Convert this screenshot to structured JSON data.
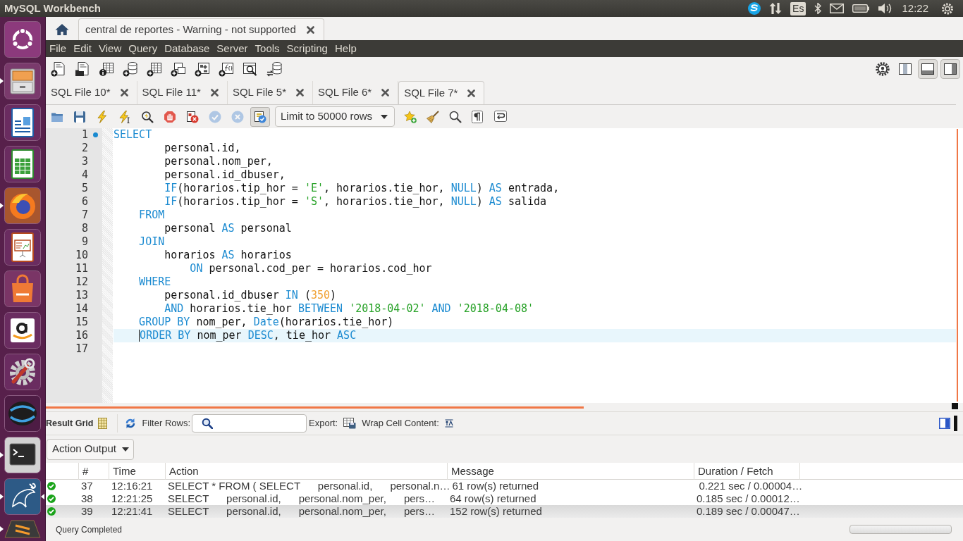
{
  "top_panel": {
    "title": "MySQL Workbench",
    "keyboard_layout": "Es",
    "clock": "12:22"
  },
  "launcher": [
    {
      "kind": "dash",
      "running": false,
      "active": false
    },
    {
      "kind": "files",
      "running": true,
      "active": false
    },
    {
      "kind": "writer",
      "running": false,
      "active": false
    },
    {
      "kind": "calc",
      "running": false,
      "active": false
    },
    {
      "kind": "browser",
      "running": true,
      "active": false
    },
    {
      "kind": "impress",
      "running": false,
      "active": false
    },
    {
      "kind": "store",
      "running": false,
      "active": false
    },
    {
      "kind": "shop",
      "running": false,
      "active": false
    },
    {
      "kind": "settings",
      "running": false,
      "active": false
    },
    {
      "kind": "swirl",
      "running": false,
      "active": false
    },
    {
      "kind": "terminal",
      "running": true,
      "active": false
    },
    {
      "kind": "workbench",
      "running": true,
      "active": true
    },
    {
      "kind": "editor",
      "running": true,
      "active": false
    }
  ],
  "connection_tabs": [
    {
      "label": "central de reportes - Warning - not supported",
      "selected": true
    }
  ],
  "menu": [
    "File",
    "Edit",
    "View",
    "Query",
    "Database",
    "Server",
    "Tools",
    "Scripting",
    "Help"
  ],
  "panel_toggles": [
    {
      "kind": "left",
      "on": false
    },
    {
      "kind": "bottom",
      "on": true
    },
    {
      "kind": "right",
      "on": true
    }
  ],
  "sql_tabs": [
    {
      "label": "SQL File 10*",
      "selected": false
    },
    {
      "label": "SQL File 11*",
      "selected": false
    },
    {
      "label": "SQL File 5*",
      "selected": false
    },
    {
      "label": "SQL File 6*",
      "selected": false
    },
    {
      "label": "SQL File 7*",
      "selected": true
    }
  ],
  "editor_toolbar": {
    "left_buttons": [
      {
        "kind": "open",
        "disabled": false,
        "pressed": false
      },
      {
        "kind": "save",
        "disabled": false,
        "pressed": false
      },
      {
        "kind": "execute",
        "disabled": false,
        "pressed": false
      },
      {
        "kind": "execute_current",
        "disabled": false,
        "pressed": false
      },
      {
        "kind": "explain",
        "disabled": false,
        "pressed": false
      },
      {
        "kind": "stop",
        "disabled": false,
        "pressed": false
      },
      {
        "kind": "stop_on_error",
        "disabled": false,
        "pressed": false
      },
      {
        "kind": "commit",
        "disabled": true,
        "pressed": false
      },
      {
        "kind": "rollback",
        "disabled": true,
        "pressed": false
      },
      {
        "kind": "autocommit",
        "disabled": false,
        "pressed": true
      }
    ],
    "limit": "Limit to 50000 rows",
    "right_buttons": [
      {
        "kind": "snippet",
        "disabled": false,
        "pressed": false
      },
      {
        "kind": "beautify",
        "disabled": false,
        "pressed": false
      },
      {
        "kind": "find",
        "disabled": false,
        "pressed": false
      },
      {
        "kind": "invisibles",
        "disabled": false,
        "pressed": false
      },
      {
        "kind": "wrap",
        "disabled": false,
        "pressed": false
      }
    ]
  },
  "editor": {
    "lines": [
      {
        "number": "1",
        "marker": true,
        "current": false,
        "tokens": [
          {
            "kind": "keyword",
            "text": "SELECT"
          }
        ]
      },
      {
        "number": "2",
        "marker": false,
        "current": false,
        "tokens": [
          {
            "kind": "plain",
            "text": "        personal.id,"
          }
        ]
      },
      {
        "number": "3",
        "marker": false,
        "current": false,
        "tokens": [
          {
            "kind": "plain",
            "text": "        personal.nom_per,"
          }
        ]
      },
      {
        "number": "4",
        "marker": false,
        "current": false,
        "tokens": [
          {
            "kind": "plain",
            "text": "        personal.id_dbuser,"
          }
        ]
      },
      {
        "number": "5",
        "marker": false,
        "current": false,
        "tokens": [
          {
            "kind": "keyword",
            "text": "        IF"
          },
          {
            "kind": "plain",
            "text": "(horarios.tip_hor = "
          },
          {
            "kind": "string",
            "text": "'E'"
          },
          {
            "kind": "plain",
            "text": ", horarios.tie_hor, "
          },
          {
            "kind": "keyword",
            "text": "NULL"
          },
          {
            "kind": "plain",
            "text": ") "
          },
          {
            "kind": "keyword",
            "text": "AS"
          },
          {
            "kind": "plain",
            "text": " entrada,"
          }
        ]
      },
      {
        "number": "6",
        "marker": false,
        "current": false,
        "tokens": [
          {
            "kind": "keyword",
            "text": "        IF"
          },
          {
            "kind": "plain",
            "text": "(horarios.tip_hor = "
          },
          {
            "kind": "string",
            "text": "'S'"
          },
          {
            "kind": "plain",
            "text": ", horarios.tie_hor, "
          },
          {
            "kind": "keyword",
            "text": "NULL"
          },
          {
            "kind": "plain",
            "text": ") "
          },
          {
            "kind": "keyword",
            "text": "AS"
          },
          {
            "kind": "plain",
            "text": " salida"
          }
        ]
      },
      {
        "number": "7",
        "marker": false,
        "current": false,
        "tokens": [
          {
            "kind": "keyword",
            "text": "    FROM"
          }
        ]
      },
      {
        "number": "8",
        "marker": false,
        "current": false,
        "tokens": [
          {
            "kind": "plain",
            "text": "        personal "
          },
          {
            "kind": "keyword",
            "text": "AS"
          },
          {
            "kind": "plain",
            "text": " personal"
          }
        ]
      },
      {
        "number": "9",
        "marker": false,
        "current": false,
        "tokens": [
          {
            "kind": "keyword",
            "text": "    JOIN"
          }
        ]
      },
      {
        "number": "10",
        "marker": false,
        "current": false,
        "tokens": [
          {
            "kind": "plain",
            "text": "        horarios "
          },
          {
            "kind": "keyword",
            "text": "AS"
          },
          {
            "kind": "plain",
            "text": " horarios"
          }
        ]
      },
      {
        "number": "11",
        "marker": false,
        "current": false,
        "tokens": [
          {
            "kind": "keyword",
            "text": "            ON"
          },
          {
            "kind": "plain",
            "text": " personal.cod_per = horarios.cod_hor"
          }
        ]
      },
      {
        "number": "12",
        "marker": false,
        "current": false,
        "tokens": [
          {
            "kind": "keyword",
            "text": "    WHERE"
          }
        ]
      },
      {
        "number": "13",
        "marker": false,
        "current": false,
        "tokens": [
          {
            "kind": "plain",
            "text": "        personal.id_dbuser "
          },
          {
            "kind": "keyword",
            "text": "IN"
          },
          {
            "kind": "plain",
            "text": " ("
          },
          {
            "kind": "number",
            "text": "350"
          },
          {
            "kind": "plain",
            "text": ")"
          }
        ]
      },
      {
        "number": "14",
        "marker": false,
        "current": false,
        "tokens": [
          {
            "kind": "keyword",
            "text": "        AND"
          },
          {
            "kind": "plain",
            "text": " horarios.tie_hor "
          },
          {
            "kind": "keyword",
            "text": "BETWEEN"
          },
          {
            "kind": "string",
            "text": " '2018-04-02'"
          },
          {
            "kind": "keyword",
            "text": " AND"
          },
          {
            "kind": "string",
            "text": " '2018-04-08'"
          }
        ]
      },
      {
        "number": "15",
        "marker": false,
        "current": false,
        "tokens": [
          {
            "kind": "keyword",
            "text": "    GROUP BY"
          },
          {
            "kind": "plain",
            "text": " nom_per, "
          },
          {
            "kind": "keyword",
            "text": "Date"
          },
          {
            "kind": "plain",
            "text": "(horarios.tie_hor)"
          }
        ]
      },
      {
        "number": "16",
        "marker": false,
        "current": true,
        "tokens": [
          {
            "kind": "keyword",
            "text": "    ORDER BY"
          },
          {
            "kind": "plain",
            "text": " nom_per "
          },
          {
            "kind": "keyword",
            "text": "DESC"
          },
          {
            "kind": "plain",
            "text": ", tie_hor "
          },
          {
            "kind": "keyword",
            "text": "ASC"
          }
        ]
      },
      {
        "number": "17",
        "marker": false,
        "current": false
      }
    ]
  },
  "result_toolbar": {
    "title": "Result Grid",
    "filter_label": "Filter Rows:",
    "export_label": "Export:",
    "wrap_label": "Wrap Cell Content:"
  },
  "output": {
    "selector": "Action Output",
    "columns": [
      "#",
      "Time",
      "Action",
      "Message",
      "Duration / Fetch"
    ],
    "rows": [
      {
        "number": "37",
        "time": "12:16:21",
        "action": "SELECT * FROM ( SELECT      personal.id,      personal.n…",
        "message": "61 row(s) returned",
        "duration": "0.221 sec / 0.00004…",
        "selected": false
      },
      {
        "number": "38",
        "time": "12:21:25",
        "action": "SELECT      personal.id,      personal.nom_per,      pers…",
        "message": "64 row(s) returned",
        "duration": "0.185 sec / 0.00012…",
        "selected": false
      },
      {
        "number": "39",
        "time": "12:21:41",
        "action": "SELECT      personal.id,      personal.nom_per,      pers…",
        "message": "152 row(s) returned",
        "duration": "0.189 sec / 0.00047…",
        "selected": true
      }
    ]
  },
  "status_bar": {
    "text": "Query Completed"
  }
}
